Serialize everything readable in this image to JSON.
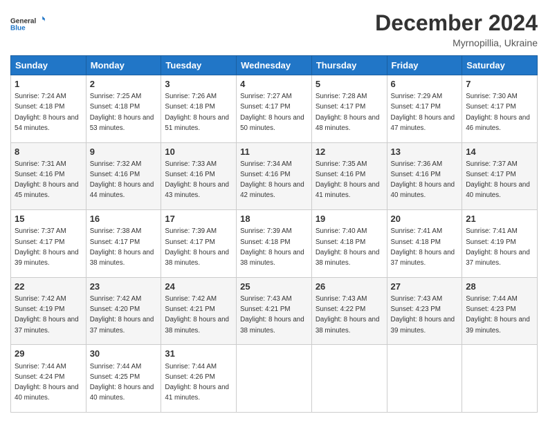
{
  "header": {
    "logo_line1": "General",
    "logo_line2": "Blue",
    "month": "December 2024",
    "location": "Myrnopillia, Ukraine"
  },
  "weekdays": [
    "Sunday",
    "Monday",
    "Tuesday",
    "Wednesday",
    "Thursday",
    "Friday",
    "Saturday"
  ],
  "weeks": [
    [
      {
        "day": 1,
        "sunrise": "7:24 AM",
        "sunset": "4:18 PM",
        "daylight": "8 hours and 54 minutes."
      },
      {
        "day": 2,
        "sunrise": "7:25 AM",
        "sunset": "4:18 PM",
        "daylight": "8 hours and 53 minutes."
      },
      {
        "day": 3,
        "sunrise": "7:26 AM",
        "sunset": "4:18 PM",
        "daylight": "8 hours and 51 minutes."
      },
      {
        "day": 4,
        "sunrise": "7:27 AM",
        "sunset": "4:17 PM",
        "daylight": "8 hours and 50 minutes."
      },
      {
        "day": 5,
        "sunrise": "7:28 AM",
        "sunset": "4:17 PM",
        "daylight": "8 hours and 48 minutes."
      },
      {
        "day": 6,
        "sunrise": "7:29 AM",
        "sunset": "4:17 PM",
        "daylight": "8 hours and 47 minutes."
      },
      {
        "day": 7,
        "sunrise": "7:30 AM",
        "sunset": "4:17 PM",
        "daylight": "8 hours and 46 minutes."
      }
    ],
    [
      {
        "day": 8,
        "sunrise": "7:31 AM",
        "sunset": "4:16 PM",
        "daylight": "8 hours and 45 minutes."
      },
      {
        "day": 9,
        "sunrise": "7:32 AM",
        "sunset": "4:16 PM",
        "daylight": "8 hours and 44 minutes."
      },
      {
        "day": 10,
        "sunrise": "7:33 AM",
        "sunset": "4:16 PM",
        "daylight": "8 hours and 43 minutes."
      },
      {
        "day": 11,
        "sunrise": "7:34 AM",
        "sunset": "4:16 PM",
        "daylight": "8 hours and 42 minutes."
      },
      {
        "day": 12,
        "sunrise": "7:35 AM",
        "sunset": "4:16 PM",
        "daylight": "8 hours and 41 minutes."
      },
      {
        "day": 13,
        "sunrise": "7:36 AM",
        "sunset": "4:16 PM",
        "daylight": "8 hours and 40 minutes."
      },
      {
        "day": 14,
        "sunrise": "7:37 AM",
        "sunset": "4:17 PM",
        "daylight": "8 hours and 40 minutes."
      }
    ],
    [
      {
        "day": 15,
        "sunrise": "7:37 AM",
        "sunset": "4:17 PM",
        "daylight": "8 hours and 39 minutes."
      },
      {
        "day": 16,
        "sunrise": "7:38 AM",
        "sunset": "4:17 PM",
        "daylight": "8 hours and 38 minutes."
      },
      {
        "day": 17,
        "sunrise": "7:39 AM",
        "sunset": "4:17 PM",
        "daylight": "8 hours and 38 minutes."
      },
      {
        "day": 18,
        "sunrise": "7:39 AM",
        "sunset": "4:18 PM",
        "daylight": "8 hours and 38 minutes."
      },
      {
        "day": 19,
        "sunrise": "7:40 AM",
        "sunset": "4:18 PM",
        "daylight": "8 hours and 38 minutes."
      },
      {
        "day": 20,
        "sunrise": "7:41 AM",
        "sunset": "4:18 PM",
        "daylight": "8 hours and 37 minutes."
      },
      {
        "day": 21,
        "sunrise": "7:41 AM",
        "sunset": "4:19 PM",
        "daylight": "8 hours and 37 minutes."
      }
    ],
    [
      {
        "day": 22,
        "sunrise": "7:42 AM",
        "sunset": "4:19 PM",
        "daylight": "8 hours and 37 minutes."
      },
      {
        "day": 23,
        "sunrise": "7:42 AM",
        "sunset": "4:20 PM",
        "daylight": "8 hours and 37 minutes."
      },
      {
        "day": 24,
        "sunrise": "7:42 AM",
        "sunset": "4:21 PM",
        "daylight": "8 hours and 38 minutes."
      },
      {
        "day": 25,
        "sunrise": "7:43 AM",
        "sunset": "4:21 PM",
        "daylight": "8 hours and 38 minutes."
      },
      {
        "day": 26,
        "sunrise": "7:43 AM",
        "sunset": "4:22 PM",
        "daylight": "8 hours and 38 minutes."
      },
      {
        "day": 27,
        "sunrise": "7:43 AM",
        "sunset": "4:23 PM",
        "daylight": "8 hours and 39 minutes."
      },
      {
        "day": 28,
        "sunrise": "7:44 AM",
        "sunset": "4:23 PM",
        "daylight": "8 hours and 39 minutes."
      }
    ],
    [
      {
        "day": 29,
        "sunrise": "7:44 AM",
        "sunset": "4:24 PM",
        "daylight": "8 hours and 40 minutes."
      },
      {
        "day": 30,
        "sunrise": "7:44 AM",
        "sunset": "4:25 PM",
        "daylight": "8 hours and 40 minutes."
      },
      {
        "day": 31,
        "sunrise": "7:44 AM",
        "sunset": "4:26 PM",
        "daylight": "8 hours and 41 minutes."
      },
      null,
      null,
      null,
      null
    ]
  ]
}
